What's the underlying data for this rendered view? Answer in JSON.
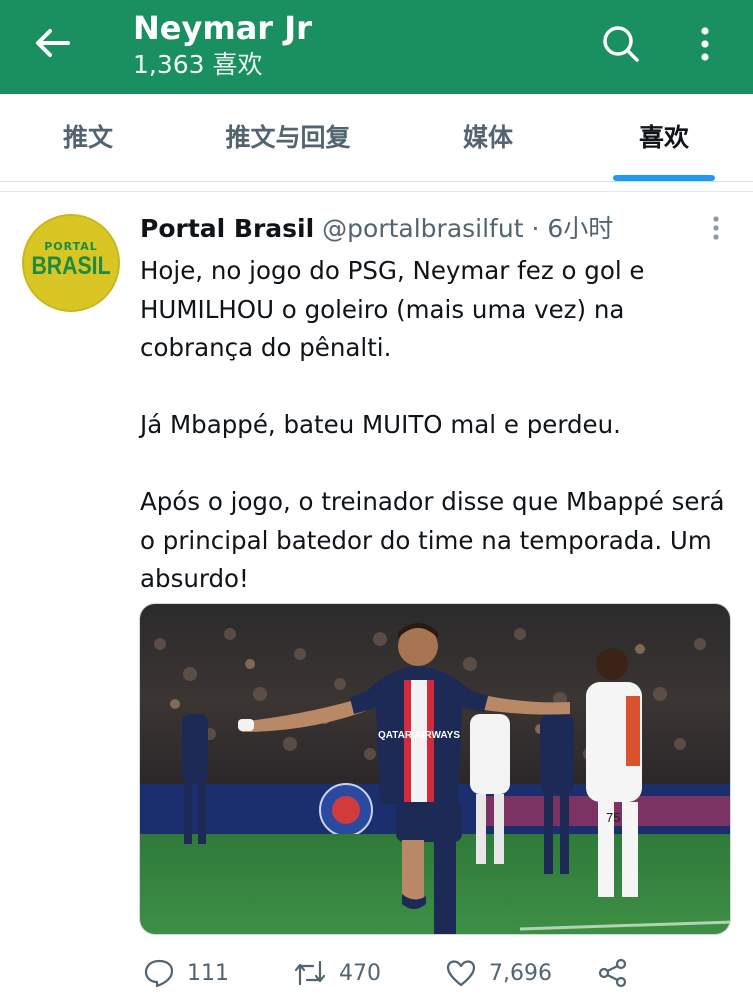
{
  "header": {
    "title": "Neymar Jr",
    "subtitle": "1,363 喜欢",
    "icons": [
      "arrow-left-icon",
      "search-icon",
      "more-vertical-icon"
    ]
  },
  "tabs": [
    {
      "label": "推文",
      "active": false
    },
    {
      "label": "推文与回复",
      "active": false
    },
    {
      "label": "媒体",
      "active": false
    },
    {
      "label": "喜欢",
      "active": true
    }
  ],
  "tweet": {
    "avatar": {
      "line1": "PORTAL",
      "line2": "BRASIL"
    },
    "author_name": "Portal Brasil",
    "handle": "@portalbrasilfut",
    "separator": "·",
    "time": "6小时",
    "paragraphs": [
      "Hoje, no jogo do PSG, Neymar fez o gol e HUMILHOU o goleiro (mais uma vez) na cobrança do pênalti.",
      "Já Mbappé, bateu MUITO mal e perdeu.",
      "Após o jogo, o treinador disse que Mbappé será o principal batedor do time na temporada. Um absurdo!"
    ],
    "media": {
      "jersey_sponsor": "QATAR AIRWAYS",
      "opponent_number": "75"
    },
    "actions": {
      "reply_count": "111",
      "retweet_count": "470",
      "like_count": "7,696"
    }
  },
  "colors": {
    "header_bg": "#1a8f5f",
    "tab_indicator": "#1d9bf0",
    "secondary_text": "#536471"
  }
}
